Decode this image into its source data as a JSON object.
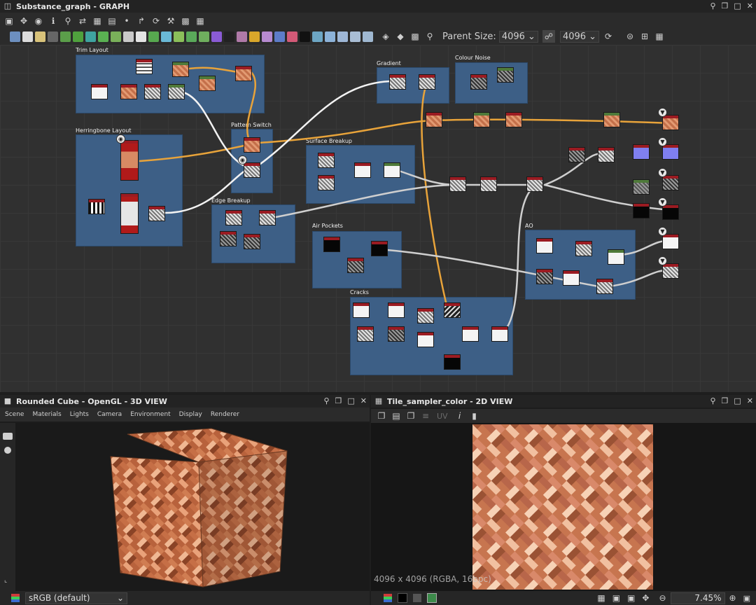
{
  "graph": {
    "title": "Substance_graph - GRAPH",
    "parent_size_label": "Parent Size:",
    "parent_size_value": "4096",
    "size_value": "4096",
    "frames": [
      "Trim Layout",
      "Herringbone Layout",
      "Pattern Switch",
      "Gradient",
      "Colour Noise",
      "Surface Breakup",
      "Edge Breakup",
      "Air Pockets",
      "AO",
      "Cracks"
    ]
  },
  "view3d": {
    "title": "Rounded Cube - OpenGL - 3D VIEW",
    "menu": [
      "Scene",
      "Materials",
      "Lights",
      "Camera",
      "Environment",
      "Display",
      "Renderer"
    ],
    "colorspace": "sRGB (default)"
  },
  "view2d": {
    "title": "Tile_sampler_color - 2D VIEW",
    "uv_label": "UV",
    "info": "4096 x 4096 (RGBA, 16bpc)",
    "zoom": "7.45%"
  },
  "colors": {
    "frame": "#3d5f86",
    "wire": "#e8a33a",
    "node_header": "#9b1b22"
  }
}
